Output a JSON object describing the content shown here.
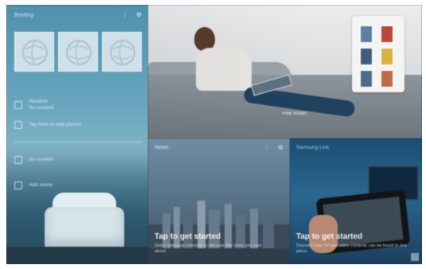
{
  "left_panel": {
    "header": "Briefing",
    "header_icons": [
      "more-icon",
      "settings-icon"
    ],
    "tiles_count": 3,
    "rows": [
      {
        "icon": "weather-icon",
        "text": "Weather",
        "subtext": "No content"
      },
      {
        "icon": "calendar-icon",
        "text": "Tap here to add places",
        "subtext": ""
      },
      {
        "icon": "message-icon",
        "text": "No content",
        "subtext": ""
      },
      {
        "icon": "music-icon",
        "text": "Add music",
        "subtext": ""
      }
    ]
  },
  "hero": {
    "caption": "Free Issues"
  },
  "news_tile": {
    "header": "News",
    "header_icons": [
      "more-icon",
      "settings-icon"
    ],
    "tip_title": "Tap to get started",
    "tip_body": "Select personal interests to discover the news you care about."
  },
  "devices_tile": {
    "header": "Samsung Link",
    "tip_title": "Tap to get started",
    "tip_body": "Discover how TV and video contents can be found in one place."
  },
  "colors": {
    "left_panel": "#5b9bb6",
    "news_tile": "#5a7489",
    "devices_tile": "#245b82"
  }
}
